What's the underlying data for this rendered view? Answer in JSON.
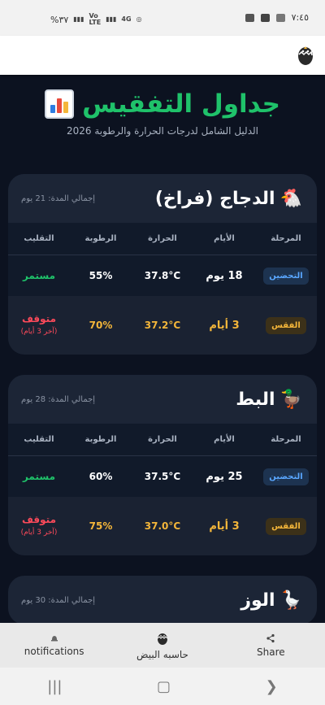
{
  "status_bar": {
    "time": "٧:٤٥",
    "battery": "%٣٧"
  },
  "hero": {
    "title": "جداول التفقيس",
    "subtitle": "الدليل الشامل لدرجات الحرارة والرطوبة 2026"
  },
  "table_headers": {
    "stage": "المرحلة",
    "days": "الأيام",
    "temp": "الحرارة",
    "humidity": "الرطوبة",
    "turning": "التقليب"
  },
  "cards": [
    {
      "emoji": "🐔",
      "title": "الدجاج (فراخ)",
      "total": "إجمالي المدة: 21 يوم",
      "rows": [
        {
          "stage": "التحضين",
          "days": "18 يوم",
          "temp": "37.8°C",
          "humidity": "55%",
          "turning": "مستمر"
        },
        {
          "stage": "الفقس",
          "days": "3 أيام",
          "temp": "37.2°C",
          "humidity": "70%",
          "turning": "متوقف",
          "note": "(آخر 3 أيام)"
        }
      ]
    },
    {
      "emoji": "🦆",
      "title": "البط",
      "total": "إجمالي المدة: 28 يوم",
      "rows": [
        {
          "stage": "التحضين",
          "days": "25 يوم",
          "temp": "37.5°C",
          "humidity": "60%",
          "turning": "مستمر"
        },
        {
          "stage": "الفقس",
          "days": "3 أيام",
          "temp": "37.0°C",
          "humidity": "75%",
          "turning": "متوقف",
          "note": "(آخر 3 أيام)"
        }
      ]
    },
    {
      "emoji": "🪿",
      "title": "الوز",
      "total": "إجمالي المدة: 30 يوم"
    }
  ],
  "bottom_nav": {
    "notifications": "notifications",
    "calculator": "حاسبه البيض",
    "share": "Share"
  },
  "colors": {
    "background": "#0c1220",
    "accent_green": "#1fc26a",
    "incubation_blue": "#5aa7ff",
    "hatch_amber": "#f4b63a",
    "stop_red": "#ff4a5a"
  }
}
